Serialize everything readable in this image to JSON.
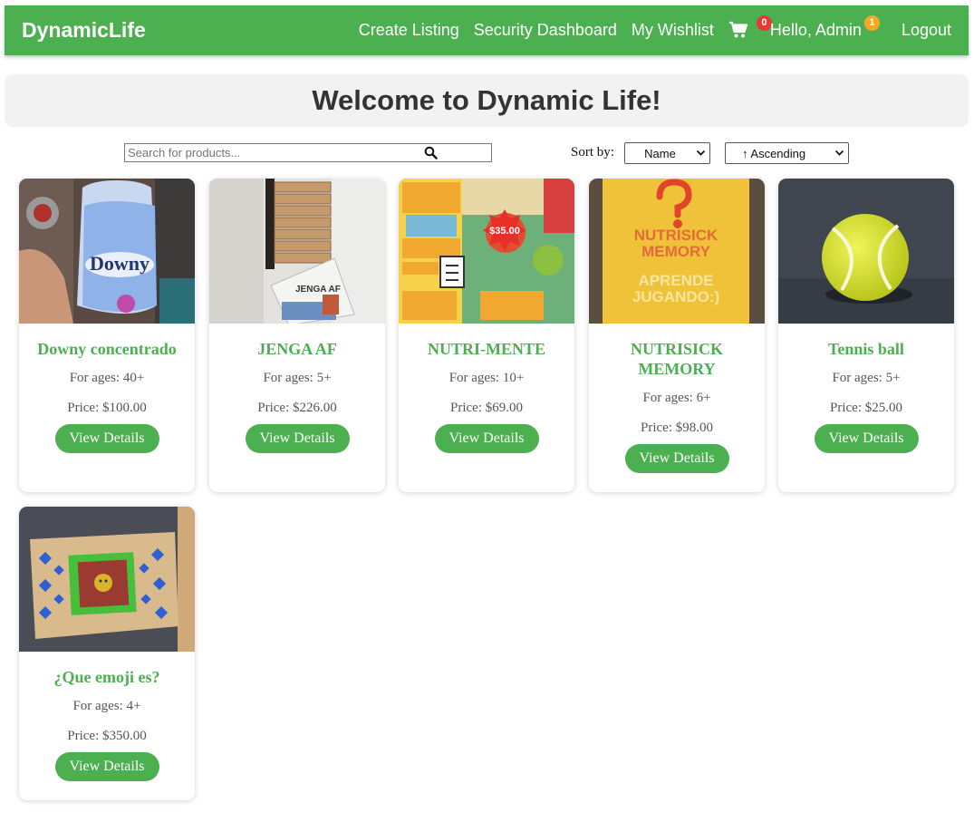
{
  "nav": {
    "brand": "DynamicLife",
    "links": {
      "create": "Create Listing",
      "security": "Security Dashboard",
      "wishlist": "My Wishlist",
      "greeting": "Hello, Admin",
      "logout": "Logout"
    },
    "cart_count": "0",
    "notification_count": "1"
  },
  "welcome": {
    "heading": "Welcome to Dynamic Life!"
  },
  "controls": {
    "search_placeholder": "Search for products...",
    "sort_label": "Sort by:",
    "sort_field": "Name",
    "sort_order": "↑ Ascending"
  },
  "products": [
    {
      "title": "Downy concentrado",
      "ages": "For ages: 40+",
      "price": "Price: $100.00",
      "button": "View Details"
    },
    {
      "title": "JENGA AF",
      "ages": "For ages: 5+",
      "price": "Price: $226.00",
      "button": "View Details"
    },
    {
      "title": "NUTRI-MENTE",
      "ages": "For ages: 10+",
      "price": "Price: $69.00",
      "button": "View Details",
      "image_text": {
        "price_tag": "$35.00"
      }
    },
    {
      "title": "NUTRISICK MEMORY",
      "ages": "For ages: 6+",
      "price": "Price: $98.00",
      "button": "View Details",
      "image_text": {
        "line1": "NUTRISICK",
        "line2": "MEMORY",
        "line3": "APRENDE",
        "line4": "JUGANDO:)"
      }
    },
    {
      "title": "Tennis ball",
      "ages": "For ages: 5+",
      "price": "Price: $25.00",
      "button": "View Details"
    },
    {
      "title": "¿Que emoji es?",
      "ages": "For ages: 4+",
      "price": "Price: $350.00",
      "button": "View Details"
    }
  ],
  "colors": {
    "primary": "#4caf50",
    "cart_badge": "#e53935",
    "notify_badge": "#f9a825",
    "panel": "#f2f2f2"
  },
  "icons": {
    "cart": "cart-icon",
    "search": "search-icon"
  }
}
